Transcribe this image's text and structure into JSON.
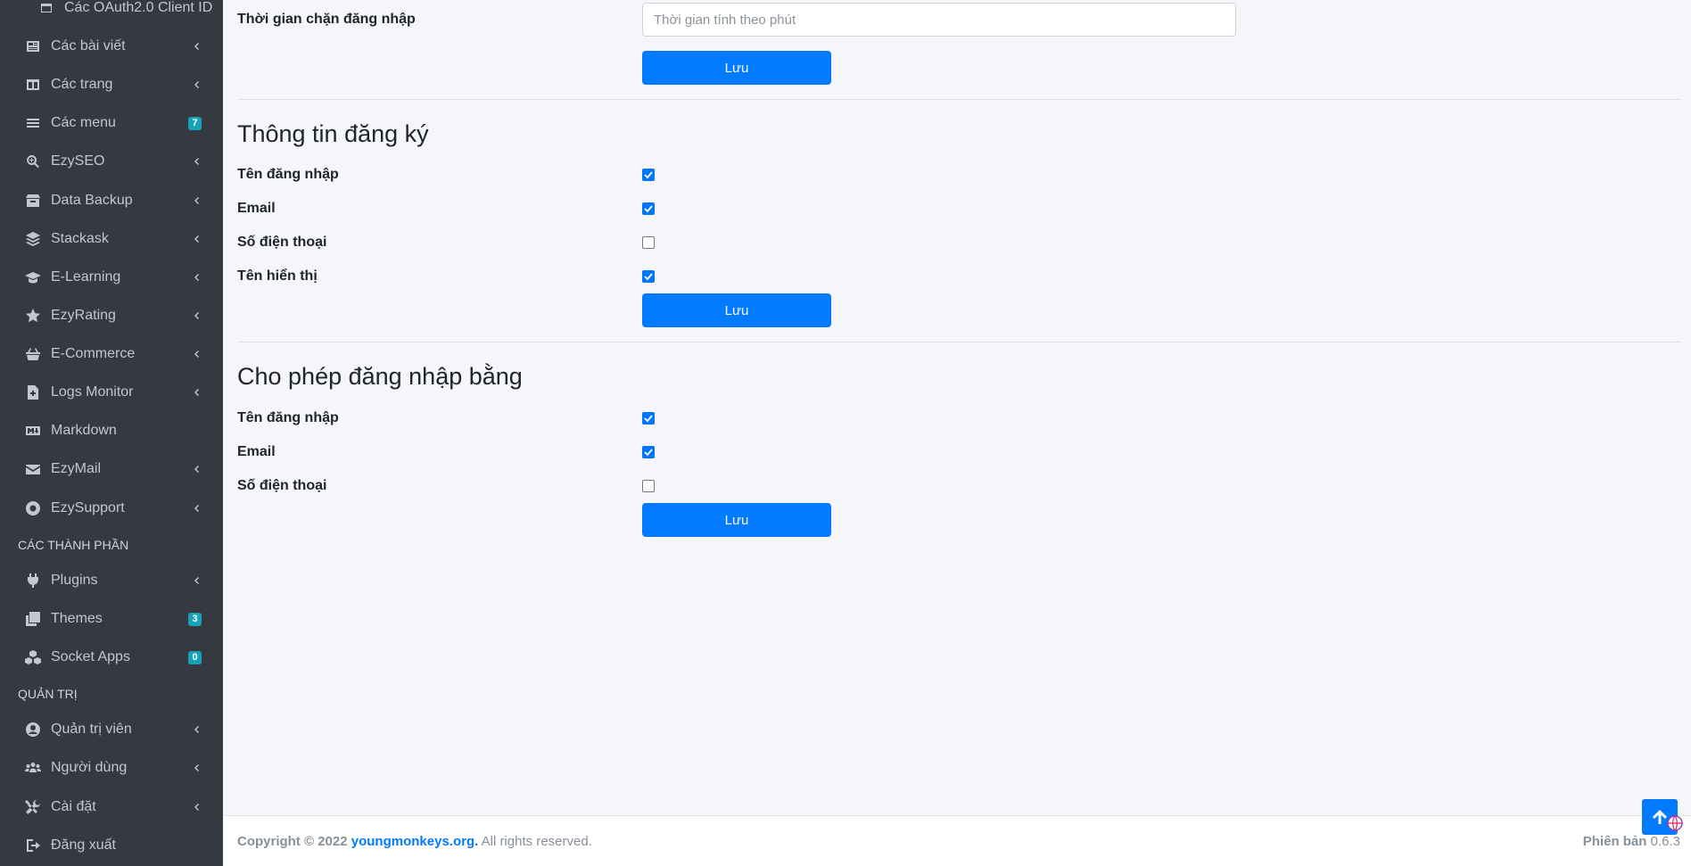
{
  "sidebar": {
    "oauth_item": "Các OAuth2.0 Client ID",
    "items": [
      {
        "label": "Các bài viết",
        "icon": "newspaper-icon"
      },
      {
        "label": "Các trang",
        "icon": "columns-icon"
      },
      {
        "label": "Các menu",
        "icon": "bars-icon",
        "badge": "7"
      },
      {
        "label": "EzySEO",
        "icon": "search-plus-icon"
      },
      {
        "label": "Data Backup",
        "icon": "box-icon"
      },
      {
        "label": "Stackask",
        "icon": "layer-group-icon"
      },
      {
        "label": "E-Learning",
        "icon": "graduation-cap-icon"
      },
      {
        "label": "EzyRating",
        "icon": "star-icon"
      },
      {
        "label": "E-Commerce",
        "icon": "shopping-basket-icon"
      },
      {
        "label": "Logs Monitor",
        "icon": "file-medical-icon"
      },
      {
        "label": "Markdown",
        "icon": "markdown-icon"
      },
      {
        "label": "EzyMail",
        "icon": "envelope-icon"
      },
      {
        "label": "EzySupport",
        "icon": "life-ring-icon"
      }
    ],
    "header_components": "CÁC THÀNH PHẦN",
    "component_items": [
      {
        "label": "Plugins",
        "icon": "plug-icon"
      },
      {
        "label": "Themes",
        "icon": "clone-icon",
        "badge": "3"
      },
      {
        "label": "Socket Apps",
        "icon": "cubes-icon",
        "badge": "0"
      }
    ],
    "header_admin": "QUẢN TRỊ",
    "admin_items": [
      {
        "label": "Quản trị viên",
        "icon": "user-circle-icon"
      },
      {
        "label": "Người dùng",
        "icon": "users-icon"
      },
      {
        "label": "Cài đặt",
        "icon": "tools-icon"
      },
      {
        "label": "Đăng xuất",
        "icon": "sign-out-icon"
      }
    ]
  },
  "login_block": {
    "label": "Thời gian chặn đăng nhập",
    "placeholder": "Thời gian tính theo phút",
    "save": "Lưu"
  },
  "register_section": {
    "title": "Thông tin đăng ký",
    "fields": [
      {
        "label": "Tên đăng nhập",
        "checked": true
      },
      {
        "label": "Email",
        "checked": true
      },
      {
        "label": "Số điện thoại",
        "checked": false
      },
      {
        "label": "Tên hiển thị",
        "checked": true
      }
    ],
    "save": "Lưu"
  },
  "login_by_section": {
    "title": "Cho phép đăng nhập bằng",
    "fields": [
      {
        "label": "Tên đăng nhập",
        "checked": true
      },
      {
        "label": "Email",
        "checked": true
      },
      {
        "label": "Số điện thoại",
        "checked": false
      }
    ],
    "save": "Lưu"
  },
  "footer": {
    "copyright": "Copyright © 2022",
    "link": "youngmonkeys.org.",
    "rights": "All rights reserved.",
    "version_label": "Phiên bản",
    "version": "0.6.3"
  },
  "colors": {
    "sidebar_bg": "#343a40",
    "primary": "#007bff",
    "badge": "#17a2b8",
    "content_bg": "#f4f6f9"
  }
}
